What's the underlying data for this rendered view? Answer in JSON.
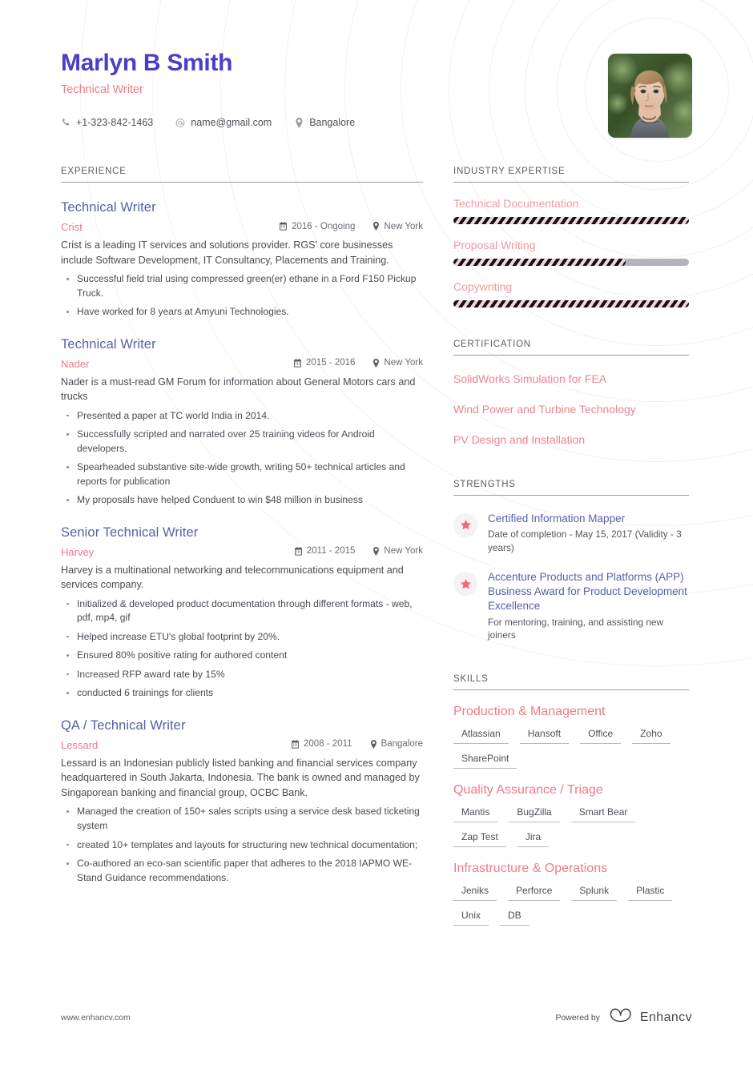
{
  "colors": {
    "name": "#4a3ec8",
    "accent_pink": "#ef7b85",
    "heading_blue": "#5560a8",
    "body_text": "#4a4c55",
    "rule_gray": "#9a9ca4",
    "bar_stripe": "#111217",
    "bar_base": "#f7d3d6",
    "bar_track": "#b4b4ba"
  },
  "header": {
    "name": "Marlyn B Smith",
    "job_title": "Technical Writer",
    "contacts": [
      {
        "icon": "phone-icon",
        "value": "+1-323-842-1463"
      },
      {
        "icon": "email-icon",
        "value": "name@gmail.com"
      },
      {
        "icon": "location-pin-icon",
        "value": "Bangalore"
      }
    ],
    "photo_alt": "profile-photo"
  },
  "experience": {
    "section_title": "EXPERIENCE",
    "entries": [
      {
        "title": "Technical Writer",
        "company": "Crist",
        "date": "2016 - Ongoing",
        "location": "New York",
        "description": "Crist is a leading IT services and solutions provider. RGS' core businesses include Software Development, IT Consultancy, Placements and Training.",
        "bullets": [
          "Successful field trial using compressed green(er) ethane in a Ford F150 Pickup Truck.",
          "Have worked for 8 years at Amyuni Technologies."
        ]
      },
      {
        "title": "Technical Writer",
        "company": "Nader",
        "date": "2015 - 2016",
        "location": "New York",
        "description": "Nader is a must-read GM Forum for information about General Motors cars and trucks",
        "bullets": [
          "Presented a paper at TC world India in 2014.",
          "Successfully scripted and narrated over 25 training videos for Android developers.",
          "Spearheaded substantive site-wide growth, writing 50+ technical articles and reports for publication",
          "My proposals have helped Conduent to win $48 million in business"
        ]
      },
      {
        "title": "Senior Technical Writer",
        "company": "Harvey",
        "date": "2011 - 2015",
        "location": "New York",
        "description": "Harvey is a multinational networking and telecommunications equipment and services company.",
        "bullets": [
          "Initialized & developed product documentation through different formats - web, pdf, mp4, gif",
          "Helped increase ETU's global footprint by 20%.",
          "Ensured 80% positive rating for authored content",
          "Increased RFP award rate by 15%",
          "conducted 6 trainings for clients"
        ]
      },
      {
        "title": "QA / Technical Writer",
        "company": "Lessard",
        "date": "2008 - 2011",
        "location": "Bangalore",
        "description": "Lessard is an Indonesian publicly listed banking and financial services company headquartered in South Jakarta, Indonesia. The bank is owned and managed by Singaporean banking and financial group, OCBC Bank.",
        "bullets": [
          "Managed the creation of 150+ sales scripts using a service desk based ticketing system",
          "created 10+ templates and layouts for structuring new technical documentation;",
          "Co-authored an eco-san scientific paper that adheres to the 2018 IAPMO WE-Stand Guidance recommendations."
        ]
      }
    ]
  },
  "industry_expertise": {
    "section_title": "INDUSTRY EXPERTISE",
    "items": [
      {
        "label": "Technical Documentation",
        "percent": 100
      },
      {
        "label": "Proposal Writing",
        "percent": 73
      },
      {
        "label": "Copywriting",
        "percent": 100
      }
    ]
  },
  "certification": {
    "section_title": "CERTIFICATION",
    "items": [
      "SolidWorks Simulation for FEA",
      "Wind Power and Turbine Technology",
      "PV Design and Installation"
    ]
  },
  "strengths": {
    "section_title": "STRENGTHS",
    "items": [
      {
        "icon": "star-icon",
        "title": "Certified Information Mapper",
        "subtitle": "Date of completion - May 15, 2017 (Validity - 3 years)"
      },
      {
        "icon": "star-icon",
        "title": "Accenture Products and Platforms (APP) Business Award for Product Development Excellence",
        "subtitle": "For mentoring, training, and assisting new joiners"
      }
    ]
  },
  "skills": {
    "section_title": "SKILLS",
    "groups": [
      {
        "title": "Production & Management",
        "tags": [
          "Atlassian",
          "Hansoft",
          "Office",
          "Zoho",
          "SharePoint"
        ]
      },
      {
        "title": "Quality Assurance / Triage",
        "tags": [
          "Mantis",
          "BugZilla",
          "Smart Bear",
          "Zap Test",
          "Jira"
        ]
      },
      {
        "title": "Infrastructure & Operations",
        "tags": [
          "Jeniks",
          "Perforce",
          "Splunk",
          "Plastic",
          "Unix",
          "DB"
        ]
      }
    ]
  },
  "footer": {
    "url": "www.enhancv.com",
    "powered_by": "Powered by",
    "brand": "Enhancv"
  }
}
